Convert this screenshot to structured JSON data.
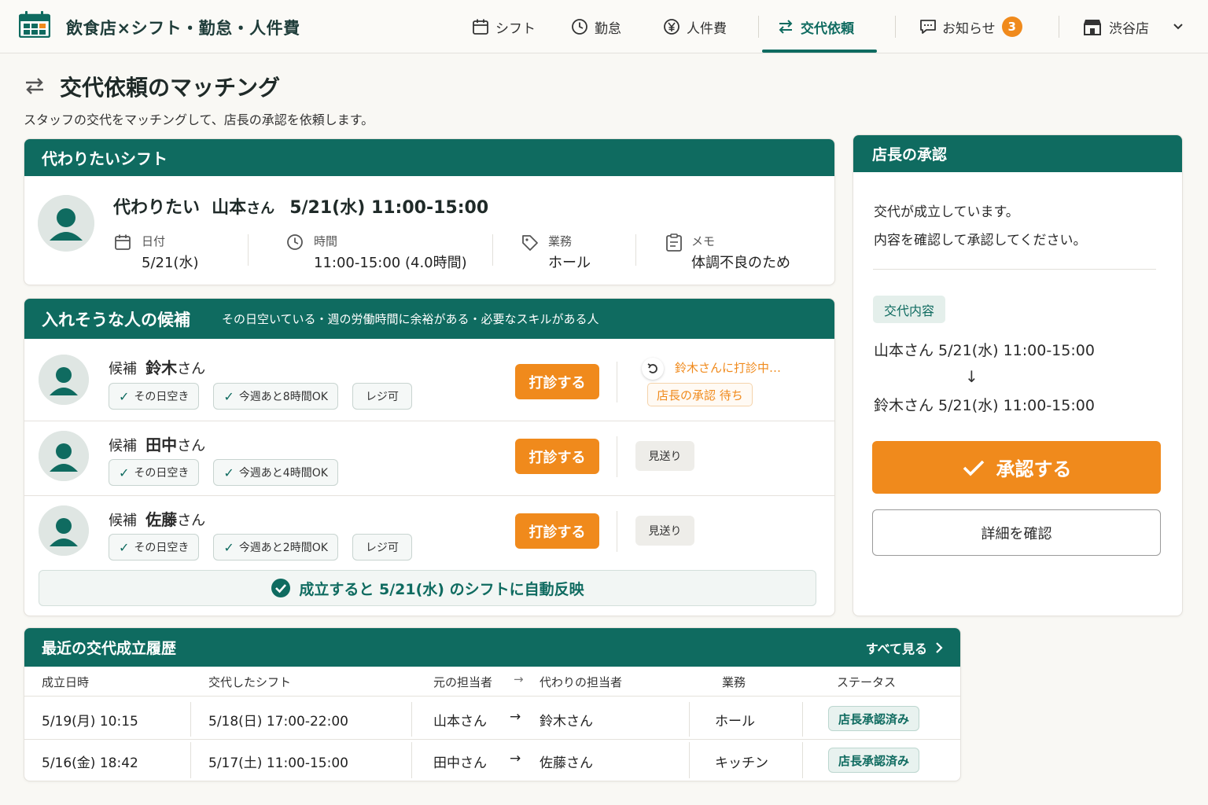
{
  "header": {
    "app_title": "飲食店×シフト・勤怠・人件費",
    "nav": {
      "shift": "シフト",
      "attendance": "勤怠",
      "labor_cost": "人件費",
      "swap": "交代依頼",
      "notice": "お知らせ",
      "notice_count": "3",
      "store": "渋谷店"
    }
  },
  "page": {
    "title": "交代依頼のマッチング",
    "subtitle": "スタッフの交代をマッチングして、店長の承認を依頼します。"
  },
  "request": {
    "heading": "代わりたいシフト",
    "prefix": "代わりたい",
    "name": "山本",
    "honorific": "さん",
    "summary": "5/21(水)  11:00-15:00",
    "fields": {
      "date_label": "日付",
      "date_value": "5/21(水)",
      "time_label": "時間",
      "time_value": "11:00-15:00 (4.0時間)",
      "role_label": "業務",
      "role_value": "ホール",
      "memo_label": "メモ",
      "memo_value": "体調不良のため"
    }
  },
  "candidates": {
    "heading": "入れそうな人の候補",
    "criteria": "その日空いている・週の労働時間に余裕がある・必要なスキルがある人",
    "prefix": "候補",
    "honorific": "さん",
    "ask_label": "打診する",
    "pass_label": "見送り",
    "items": [
      {
        "name": "鈴木",
        "tags": [
          "その日空き",
          "今週あと8時間OK"
        ],
        "skill": "レジ可",
        "status": "鈴木さんに打診中…",
        "status2": "店長の承認 待ち"
      },
      {
        "name": "田中",
        "tags": [
          "その日空き",
          "今週あと4時間OK"
        ]
      },
      {
        "name": "佐藤",
        "tags": [
          "その日空き",
          "今週あと2時間OK"
        ],
        "skill": "レジ可"
      }
    ],
    "auto_reflect": "成立すると 5/21(水) のシフトに自動反映"
  },
  "approval": {
    "heading": "店長の承認",
    "message_line1": "交代が成立しています。",
    "message_line2": "内容を確認して承認してください。",
    "content_label": "交代内容",
    "from_line": "山本さん  5/21(水)  11:00-15:00",
    "arrow": "↓",
    "to_line": "鈴木さん  5/21(水)  11:00-15:00",
    "approve_label": "承認する",
    "detail_label": "詳細を確認"
  },
  "history": {
    "heading": "最近の交代成立履歴",
    "see_all": "すべて見る",
    "columns": {
      "datetime": "成立日時",
      "shift": "交代したシフト",
      "original": "元の担当者",
      "arrow": "→",
      "replacement": "代わりの担当者",
      "role": "業務",
      "status": "ステータス"
    },
    "rows": [
      {
        "datetime": "5/19(月) 10:15",
        "shift": "5/18(日) 17:00-22:00",
        "from": "山本さん",
        "arrow": "→",
        "to": "鈴木さん",
        "role": "ホール",
        "status": "店長承認済み"
      },
      {
        "datetime": "5/16(金) 18:42",
        "shift": "5/17(土) 11:00-15:00",
        "from": "田中さん",
        "arrow": "→",
        "to": "佐藤さん",
        "role": "キッチン",
        "status": "店長承認済み"
      }
    ]
  },
  "colors": {
    "brand": "#0f6b60",
    "accent": "#f08a1c",
    "badge": "#f08a1c"
  },
  "icons": [
    "calendar-icon",
    "clock-icon",
    "yen-icon",
    "swap-icon",
    "chat-icon",
    "store-icon",
    "chevron-down-icon",
    "tag-icon",
    "memo-icon",
    "check-icon",
    "undo-icon",
    "chevron-right-icon",
    "user-icon"
  ]
}
